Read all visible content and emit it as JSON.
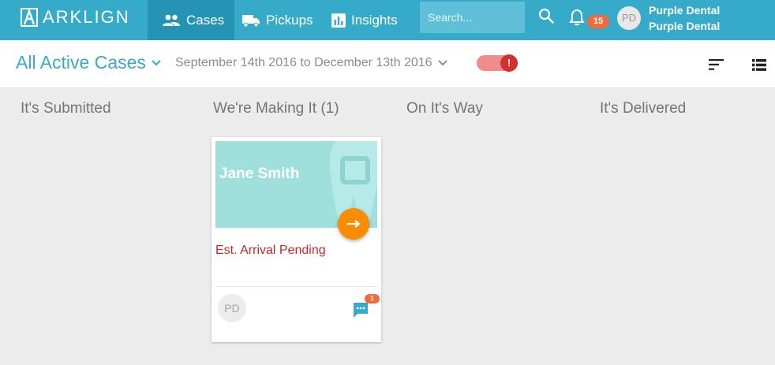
{
  "brand": {
    "name": "ARKLIGN"
  },
  "nav": {
    "items": [
      {
        "label": "Cases",
        "icon": "people-icon",
        "active": true
      },
      {
        "label": "Pickups",
        "icon": "truck-icon",
        "active": false
      },
      {
        "label": "Insights",
        "icon": "bar-chart-icon",
        "active": false
      }
    ]
  },
  "search": {
    "placeholder": "Search..."
  },
  "notifications": {
    "count": "15"
  },
  "account": {
    "initials": "PD",
    "line1": "Purple Dental",
    "line2": "Purple Dental"
  },
  "filters": {
    "view": "All Active Cases",
    "date_range": "September 14th 2016 to December 13th 2016",
    "toggle_alert": "!"
  },
  "columns": [
    {
      "title": "It's Submitted"
    },
    {
      "title": "We're Making It (1)"
    },
    {
      "title": "On It's Way"
    },
    {
      "title": "It's Delivered"
    }
  ],
  "cases": [
    {
      "patient": "Jane Smith",
      "status": "Est. Arrival Pending",
      "assignee_initials": "PD",
      "message_count": "1"
    }
  ],
  "colors": {
    "brand": "#35aac9",
    "nav_active": "#2594b4",
    "card_hero": "#9fe0dd",
    "action": "#fb8c00",
    "status_text": "#c62828",
    "badge": "#f26b3a"
  }
}
